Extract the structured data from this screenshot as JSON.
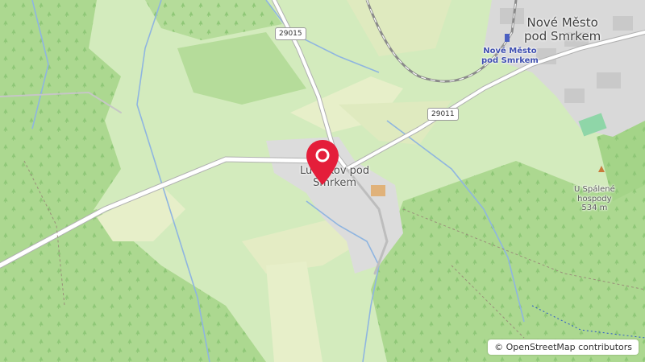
{
  "map": {
    "labels": {
      "town_line1": "Nové Město",
      "town_line2": "pod Smrkem",
      "station_line1": "Nové Město",
      "station_line2": "pod Smrkem",
      "village_line1": "Ludvíkov pod",
      "village_line2": "Smrkem",
      "peak_line1": "U Spálené",
      "peak_line2": "hospody",
      "peak_elevation": "534 m"
    },
    "road_shields": {
      "r1": "29015",
      "r2": "29011"
    },
    "attribution": {
      "copyright_symbol": "©",
      "text": "OpenStreetMap contributors"
    },
    "marker": {
      "icon": "map-pin-icon",
      "color": "#e41e3a"
    },
    "colors": {
      "meadow": "#d3ebbd",
      "forest": "#a9d88d",
      "farmland": "#e8efcc",
      "urban": "#d9d9d9",
      "water": "#8fb5e0"
    }
  }
}
